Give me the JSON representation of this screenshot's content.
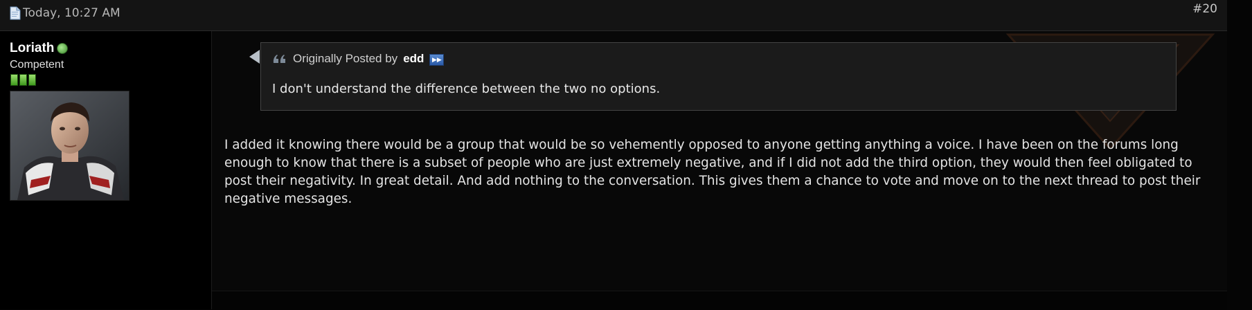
{
  "post": {
    "date": "Today, 10:27 AM",
    "number": "#20"
  },
  "user": {
    "name": "Loriath",
    "title": "Competent",
    "reputation_bars": 3
  },
  "quote": {
    "prefix": "Originally Posted by",
    "author": "edd",
    "text": "I don't understand the difference between the two no options."
  },
  "message": "I added it knowing there would be a group that would be so vehemently opposed to anyone getting anything a voice. I have been on the forums long enough to know that there is a subset of people who are just extremely negative, and if I did not add the third option, they would then feel obligated to post their negativity. In great detail. And add nothing to the conversation. This gives them a chance to vote and move on to the next thread to post their negative messages.",
  "icons": {
    "date": "document-icon",
    "online": "online-status-icon",
    "quote": "quote-icon",
    "view_post": "view-post-icon"
  },
  "colors": {
    "background": "#050505",
    "header": "#141414",
    "quote_box": "#1b1b1b",
    "text": "#e4e4e4",
    "online_green": "#5cb83a"
  }
}
